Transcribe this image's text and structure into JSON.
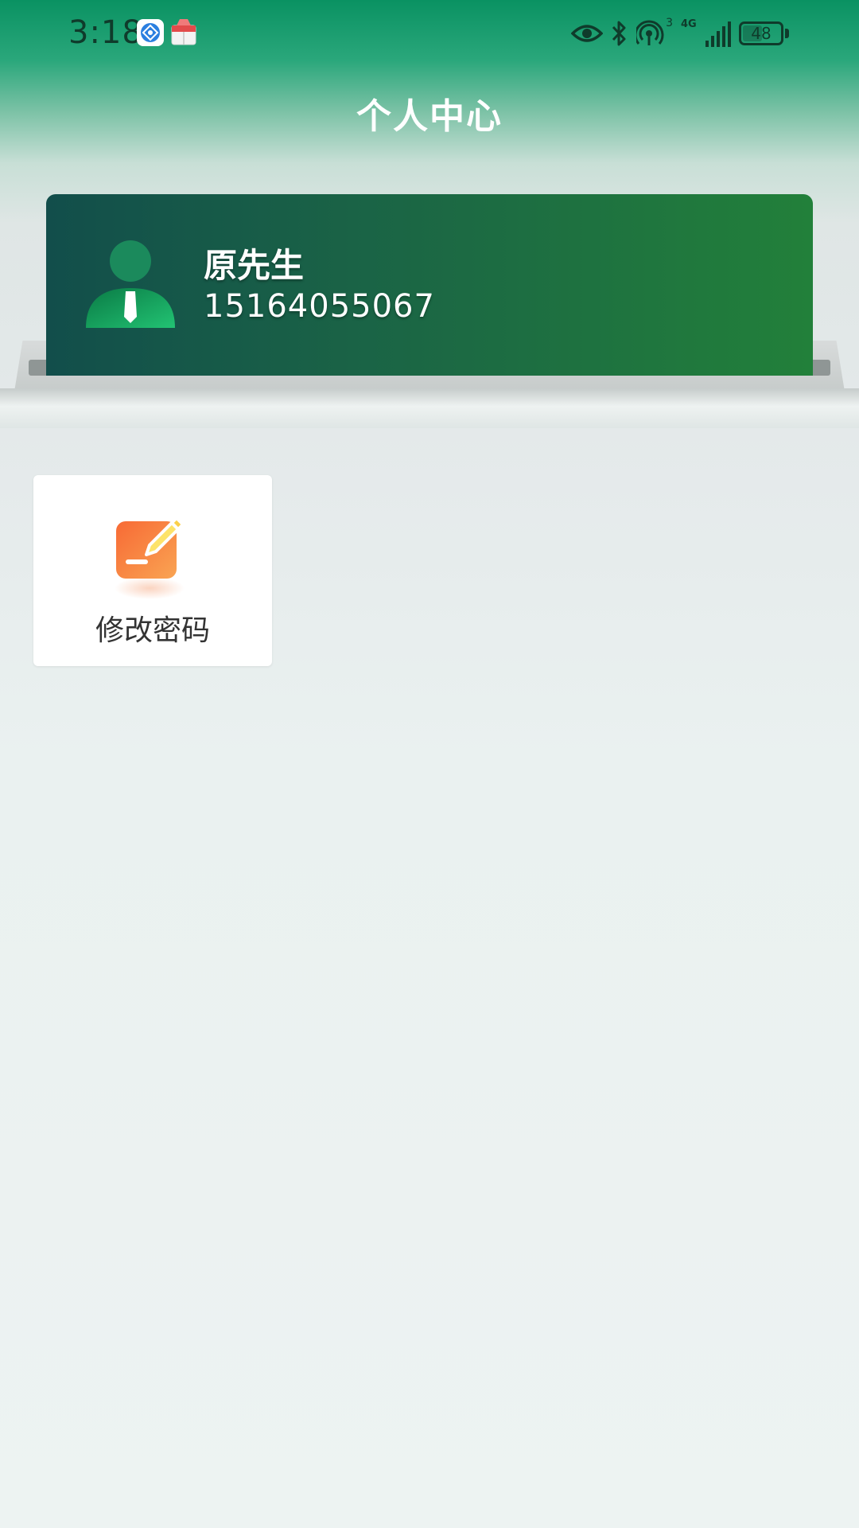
{
  "status_bar": {
    "time": "3:18",
    "network_type": "4G",
    "hotspot_count": "3",
    "battery_level": "48",
    "icons": [
      "browser-app-icon",
      "shopping-app-icon",
      "eye-icon",
      "bluetooth-icon",
      "hotspot-icon",
      "signal-icon",
      "battery-icon"
    ]
  },
  "header": {
    "title": "个人中心"
  },
  "profile": {
    "name": "原先生",
    "phone": "15164055067",
    "avatar_icon": "user-avatar-icon"
  },
  "functions": [
    {
      "label": "修改密码",
      "icon": "edit-password-icon"
    }
  ],
  "colors": {
    "header_green": "#0a9262",
    "card_start": "#124e4b",
    "card_end": "#22803a",
    "tile_icon_orange": "#f7843f",
    "page_background": "#ecf3f2"
  }
}
